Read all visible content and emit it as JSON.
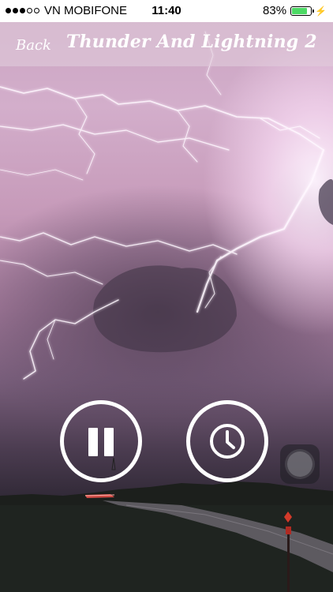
{
  "status_bar": {
    "carrier": "VN MOBIFONE",
    "time": "11:40",
    "battery_percent": "83%",
    "battery_level": 0.83,
    "signal_bars_filled": 3,
    "signal_bars_total": 5,
    "icons": [
      "signal-dots-icon",
      "battery-icon",
      "charging-bolt-icon"
    ]
  },
  "nav": {
    "back_label": "Back",
    "title": "Thunder And Lightning 2"
  },
  "controls": {
    "pause_icon": "pause-icon",
    "timer_icon": "clock-icon"
  },
  "colors": {
    "battery_fill": "#4cd964",
    "nav_tint": "#e1cddc",
    "control_stroke": "#ffffff"
  }
}
